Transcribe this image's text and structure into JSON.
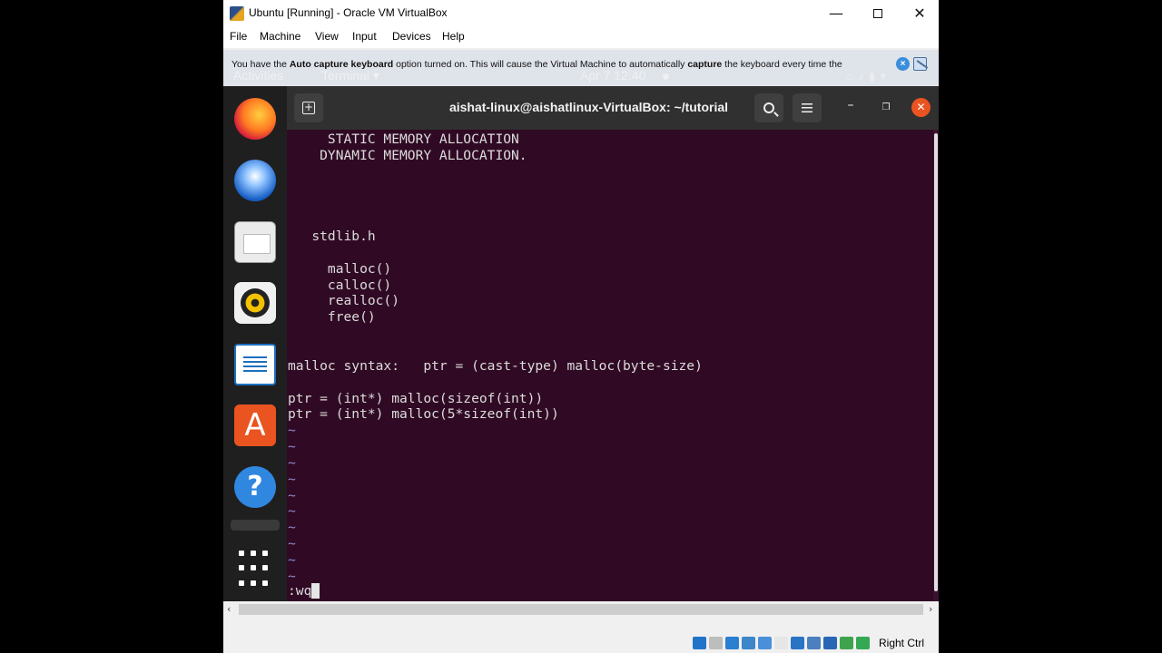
{
  "window": {
    "title": "Ubuntu [Running] - Oracle VM VirtualBox"
  },
  "menubar": [
    "File",
    "Machine",
    "View",
    "Input",
    "Devices",
    "Help"
  ],
  "notification": {
    "part1": "You have the ",
    "bold1": "Auto capture keyboard",
    "part2": " option turned on. This will cause the Virtual Machine to automatically ",
    "bold2": "capture",
    "part3": " the keyboard every time the"
  },
  "gnome_panel": {
    "activities": "Activities",
    "app_menu": "Terminal ▾",
    "clock": "Apr 7  12:40"
  },
  "dock": {
    "apps": [
      "firefox-icon",
      "thunderbird-icon",
      "files-icon",
      "rhythmbox-icon",
      "libreoffice-writer-icon",
      "ubuntu-software-icon",
      "help-icon",
      "show-applications-icon"
    ]
  },
  "terminal": {
    "title": "aishat-linux@aishatlinux-VirtualBox: ~/tutorial",
    "lines": [
      "     STATIC MEMORY ALLOCATION",
      "    DYNAMIC MEMORY ALLOCATION.",
      "",
      "",
      "",
      "",
      "   stdlib.h",
      "",
      "     malloc()",
      "     calloc()",
      "     realloc()",
      "     free()",
      "",
      "",
      "malloc syntax:   ptr = (cast-type) malloc(byte-size)",
      "",
      "ptr = (int*) malloc(sizeof(int))",
      "ptr = (int*) malloc(5*sizeof(int))"
    ],
    "tilde_lines": [
      "~",
      "~",
      "~",
      "~",
      "~",
      "~",
      "~",
      "~",
      "~",
      "~"
    ],
    "command": ":wq"
  },
  "statusbar": {
    "host_key": "Right Ctrl",
    "indicator_colors": [
      "#1f74c9",
      "#bdbdbd",
      "#2b7fd0",
      "#3c86c9",
      "#4a90d9",
      "#e6e6e6",
      "#2a74c4",
      "#4b7fc0",
      "#2a66b6",
      "#3fa34d",
      "#34a853"
    ]
  }
}
